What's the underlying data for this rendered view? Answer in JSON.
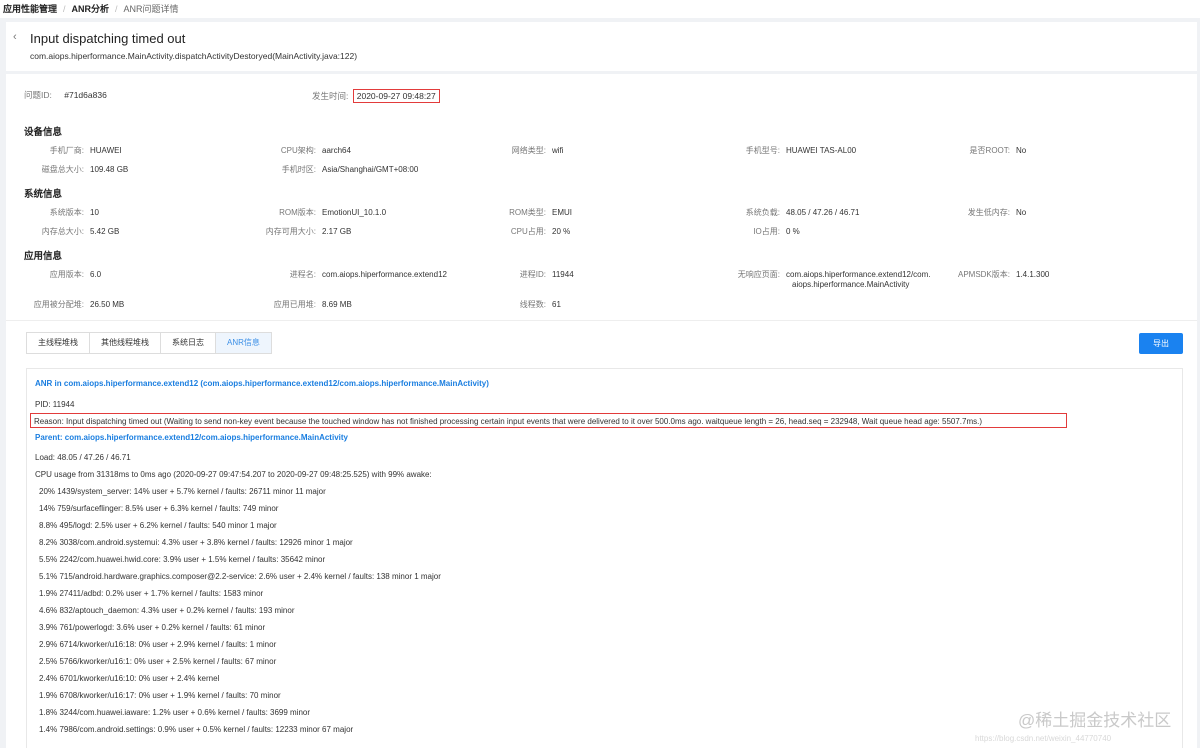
{
  "breadcrumb": [
    "应用性能管理",
    "ANR分析",
    "ANR问题详情"
  ],
  "header": {
    "back_icon": "‹",
    "title": "Input dispatching timed out",
    "subtitle": "com.aiops.hiperformance.MainActivity.dispatchActivityDestoryed(MainActivity.java:122)"
  },
  "meta": {
    "issue_id_label": "问题ID:",
    "issue_id": "#71d6a836",
    "time_label": "发生时间:",
    "time": "2020-09-27 09:48:27"
  },
  "device": {
    "title": "设备信息",
    "items": [
      {
        "k": "手机厂商:",
        "v": "HUAWEI"
      },
      {
        "k": "CPU架构:",
        "v": "aarch64"
      },
      {
        "k": "网络类型:",
        "v": "wifi"
      },
      {
        "k": "手机型号:",
        "v": "HUAWEI TAS-AL00"
      },
      {
        "k": "是否ROOT:",
        "v": "No"
      },
      {
        "k": "磁盘总大小:",
        "v": "109.48 GB"
      },
      {
        "k": "手机时区:",
        "v": "Asia/Shanghai/GMT+08:00"
      }
    ]
  },
  "system": {
    "title": "系统信息",
    "items": [
      {
        "k": "系统版本:",
        "v": "10"
      },
      {
        "k": "ROM版本:",
        "v": "EmotionUI_10.1.0"
      },
      {
        "k": "ROM类型:",
        "v": "EMUI"
      },
      {
        "k": "系统负载:",
        "v": "48.05 / 47.26 / 46.71"
      },
      {
        "k": "发生低内存:",
        "v": "No"
      },
      {
        "k": "内存总大小:",
        "v": "5.42 GB"
      },
      {
        "k": "内存可用大小:",
        "v": "2.17 GB"
      },
      {
        "k": "CPU占用:",
        "v": "20 %"
      },
      {
        "k": "IO占用:",
        "v": "0 %"
      }
    ]
  },
  "app": {
    "title": "应用信息",
    "items": [
      {
        "k": "应用版本:",
        "v": "6.0"
      },
      {
        "k": "进程名:",
        "v": "com.aiops.hiperformance.extend12"
      },
      {
        "k": "进程ID:",
        "v": "11944"
      },
      {
        "k": "无响应页面:",
        "v": "com.aiops.hiperformance.extend12/com."
      },
      {
        "k": "APMSDK版本:",
        "v": "1.4.1.300"
      },
      {
        "k": "应用被分配堆:",
        "v": "26.50 MB"
      },
      {
        "k": "应用已用堆:",
        "v": "8.69 MB"
      },
      {
        "k": "线程数:",
        "v": "61"
      }
    ],
    "page_line2": "aiops.hiperformance.MainActivity"
  },
  "tabs": [
    "主线程堆栈",
    "其他线程堆栈",
    "系统日志",
    "ANR信息"
  ],
  "export_label": "导出",
  "log": {
    "header": "ANR in com.aiops.hiperformance.extend12 (com.aiops.hiperformance.extend12/com.aiops.hiperformance.MainActivity)",
    "pid": "PID: 11944",
    "reason": "Reason: Input dispatching timed out (Waiting to send non-key event because the touched window has not finished processing certain input events that were delivered to it over 500.0ms ago. waitqueue length = 26, head.seq = 232948, Wait queue head age: 5507.7ms.)",
    "parent": "Parent: com.aiops.hiperformance.extend12/com.aiops.hiperformance.MainActivity",
    "load": "Load: 48.05 / 47.26 / 46.71",
    "cpu_usage": "CPU usage from 31318ms to 0ms ago (2020-09-27 09:47:54.207 to 2020-09-27 09:48:25.525) with 99% awake:",
    "lines": [
      "20% 1439/system_server: 14% user + 5.7% kernel / faults: 26711 minor 11 major",
      "14% 759/surfaceflinger: 8.5% user + 6.3% kernel / faults: 749 minor",
      "8.8% 495/logd: 2.5% user + 6.2% kernel / faults: 540 minor 1 major",
      "8.2% 3038/com.android.systemui: 4.3% user + 3.8% kernel / faults: 12926 minor 1 major",
      "5.5% 2242/com.huawei.hwid.core: 3.9% user + 1.5% kernel / faults: 35642 minor",
      "5.1% 715/android.hardware.graphics.composer@2.2-service: 2.6% user + 2.4% kernel / faults: 138 minor 1 major",
      "1.9% 27411/adbd: 0.2% user + 1.7% kernel / faults: 1583 minor",
      "4.6% 832/aptouch_daemon: 4.3% user + 0.2% kernel / faults: 193 minor",
      "3.9% 761/powerlogd: 3.6% user + 0.2% kernel / faults: 61 minor",
      "2.9% 6714/kworker/u16:18: 0% user + 2.9% kernel / faults: 1 minor",
      "2.5% 5766/kworker/u16:1: 0% user + 2.5% kernel / faults: 67 minor",
      "2.4% 6701/kworker/u16:10: 0% user + 2.4% kernel",
      "1.9% 6708/kworker/u16:17: 0% user + 1.9% kernel / faults: 70 minor",
      "1.8% 3244/com.huawei.iaware: 1.2% user + 0.6% kernel / faults: 3699 minor",
      "1.4% 7986/com.android.settings: 0.9% user + 0.5% kernel / faults: 12233 minor 67 major"
    ]
  },
  "watermark": "@稀土掘金技术社区",
  "watermark_url": "https://blog.csdn.net/weixin_44770740"
}
